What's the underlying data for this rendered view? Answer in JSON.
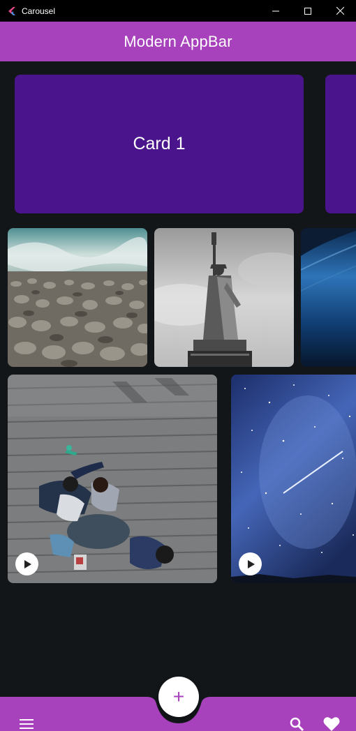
{
  "window": {
    "title": "Carousel",
    "controls": [
      "minimize",
      "maximize",
      "close"
    ]
  },
  "appbar": {
    "title": "Modern AppBar",
    "color": "#a742bc"
  },
  "cards": [
    {
      "label": "Card 1",
      "color": "#4a148c"
    },
    {
      "label": "",
      "color": "#4a148c"
    }
  ],
  "images": {
    "row1": [
      "pebble-beach-photo",
      "statue-of-liberty-photo",
      "ocean-wave-photo"
    ],
    "row2": [
      {
        "name": "boardwalk-people-video",
        "has_play": true
      },
      {
        "name": "starry-sky-video",
        "has_play": true
      }
    ]
  },
  "bottom_bar": {
    "fab_icon": "plus-icon",
    "left_icon": "menu-icon",
    "right_icons": [
      "search-icon",
      "heart-icon"
    ],
    "color": "#a742bc"
  },
  "colors": {
    "background": "#131619",
    "accent": "#a742bc",
    "card": "#4a148c"
  }
}
